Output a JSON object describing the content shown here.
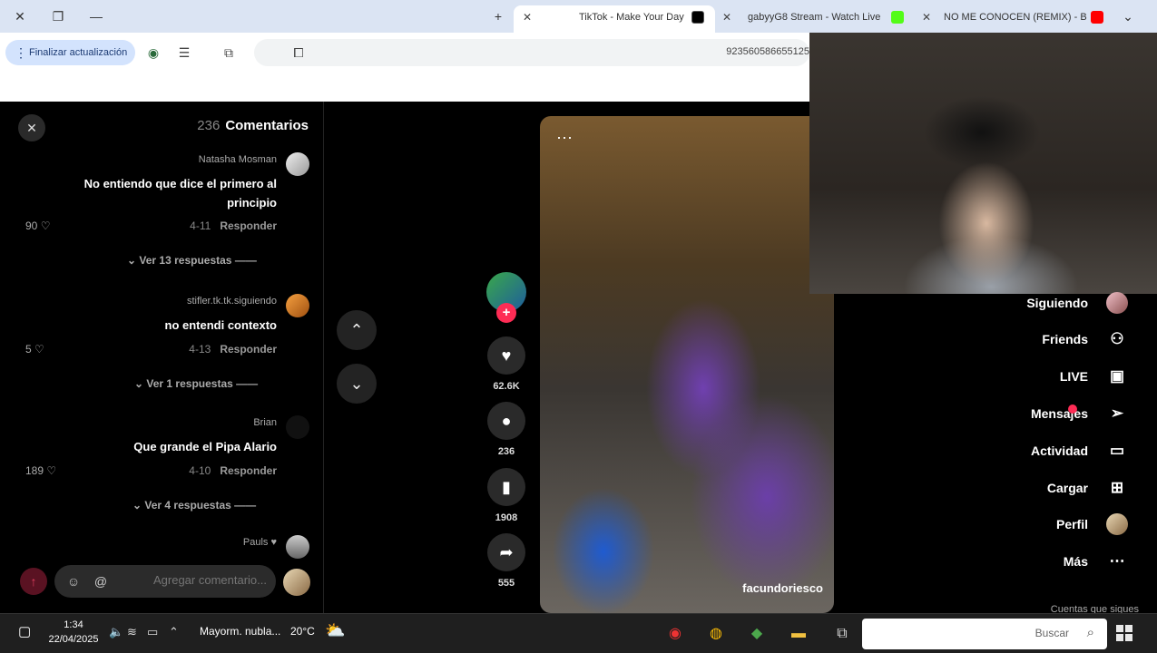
{
  "browser": {
    "tabs": [
      {
        "label": "NO ME CONOCEN (REMIX) - Bi",
        "favicon": "youtube-icon",
        "color": "#ff0000"
      },
      {
        "label": "gabyyG8 Stream - Watch Live",
        "favicon": "kick-icon",
        "color": "#53fc18"
      },
      {
        "label": "TikTok - Make Your Day",
        "favicon": "tiktok-icon",
        "color": "#000000"
      }
    ],
    "new_tab": "+",
    "update_button": "Finalizar actualización",
    "url": "923560586655125"
  },
  "comments": {
    "title": "Comentarios",
    "count": "236",
    "items": [
      {
        "author": "Natasha Mosman",
        "text": "No entiendo que dice el primero al principio",
        "date": "4-11",
        "reply": "Responder",
        "likes": "90",
        "replies": "Ver 13 respuestas"
      },
      {
        "author": "stifler.tk.tk.siguiendo",
        "text": "no entendi contexto",
        "date": "4-13",
        "reply": "Responder",
        "likes": "5",
        "replies": "Ver 1 respuestas"
      },
      {
        "author": "Brian",
        "text": "Que grande el Pipa Alario",
        "date": "4-10",
        "reply": "Responder",
        "likes": "189",
        "replies": "Ver 4 respuestas"
      },
      {
        "author": "Pauls ♥",
        "text": "",
        "date": "",
        "reply": "",
        "likes": "",
        "replies": ""
      }
    ],
    "input_placeholder": "Agregar comentario..."
  },
  "video": {
    "author": "facundoriesco",
    "likes": "62.6K",
    "comments": "236",
    "saves": "1908",
    "shares": "555"
  },
  "sidebar": {
    "items": [
      {
        "label": "Siguiendo",
        "icon": "avatar-icon"
      },
      {
        "label": "Friends",
        "icon": "friends-icon"
      },
      {
        "label": "LIVE",
        "icon": "live-icon"
      },
      {
        "label": "Mensajes",
        "icon": "messages-icon"
      },
      {
        "label": "Actividad",
        "icon": "activity-icon"
      },
      {
        "label": "Cargar",
        "icon": "upload-icon"
      },
      {
        "label": "Perfil",
        "icon": "profile-icon"
      },
      {
        "label": "Más",
        "icon": "more-icon"
      }
    ],
    "accounts_label": "Cuentas que sigues"
  },
  "taskbar": {
    "search_placeholder": "Buscar",
    "weather_temp": "20°C",
    "weather_desc": "Mayorm. nubla...",
    "time": "1:34",
    "date": "22/04/2025"
  }
}
